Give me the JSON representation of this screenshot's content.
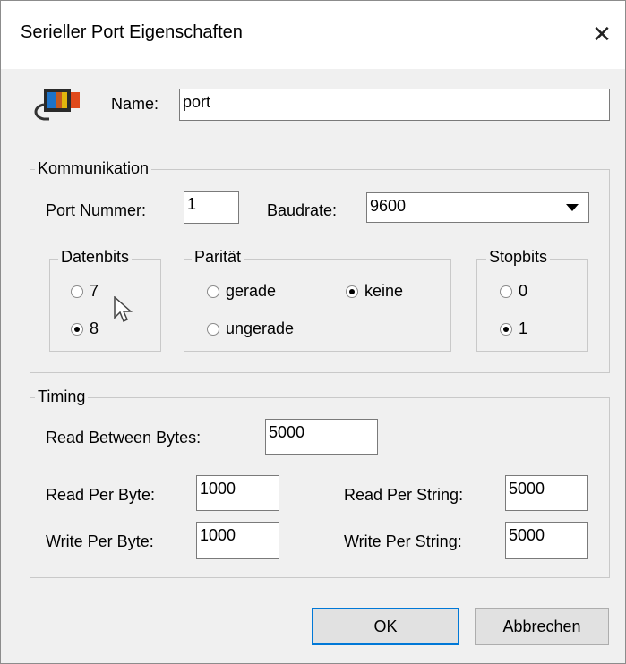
{
  "window": {
    "title": "Serieller Port Eigenschaften",
    "close_glyph": "✕"
  },
  "name_row": {
    "label": "Name:",
    "value": "port",
    "icon": "serial-port-icon"
  },
  "kommunikation": {
    "legend": "Kommunikation",
    "port_label": "Port Nummer:",
    "port_value": "1",
    "baud_label": "Baudrate:",
    "baud_value": "9600",
    "datenbits": {
      "legend": "Datenbits",
      "opt7": "7",
      "opt8": "8",
      "selected": "8"
    },
    "paritaet": {
      "legend": "Parität",
      "gerade": "gerade",
      "keine": "keine",
      "ungerade": "ungerade",
      "selected": "keine"
    },
    "stopbits": {
      "legend": "Stopbits",
      "opt0": "0",
      "opt1": "1",
      "selected": "1"
    }
  },
  "timing": {
    "legend": "Timing",
    "rbb_label": "Read Between Bytes:",
    "rbb_value": "5000",
    "rpb_label": "Read Per Byte:",
    "rpb_value": "1000",
    "rps_label": "Read Per String:",
    "rps_value": "5000",
    "wpb_label": "Write Per Byte:",
    "wpb_value": "1000",
    "wps_label": "Write Per String:",
    "wps_value": "5000"
  },
  "buttons": {
    "ok": "OK",
    "cancel": "Abbrechen"
  }
}
